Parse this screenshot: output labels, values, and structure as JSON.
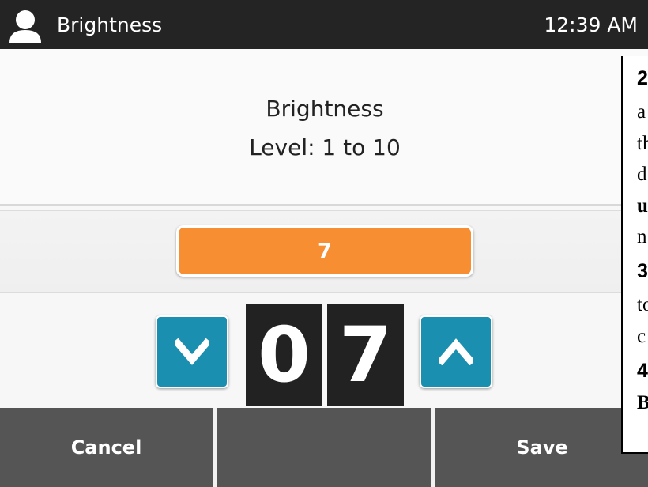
{
  "topbar": {
    "title": "Brightness",
    "time": "12:39 AM",
    "user_icon": "user-icon"
  },
  "heading": {
    "line1": "Brightness",
    "line2": "Level: 1 to 10"
  },
  "level": {
    "value": 7,
    "display": "7",
    "range_min": 1,
    "range_max": 10,
    "digits": [
      "0",
      "7"
    ],
    "down_icon": "chevron-down-icon",
    "up_icon": "chevron-up-icon"
  },
  "softkeys": {
    "left": "Cancel",
    "middle": "",
    "right": "Save"
  },
  "instructions": {
    "lines": [
      "2",
      "a",
      "th",
      "d",
      "u",
      "n",
      "3",
      "to",
      "c",
      "4",
      "B"
    ]
  },
  "colors": {
    "topbar": "#242424",
    "value_bar": "#f78e32",
    "step_button": "#1a8fb0",
    "digit_background": "#222222",
    "softkey_bar": "#555555"
  }
}
